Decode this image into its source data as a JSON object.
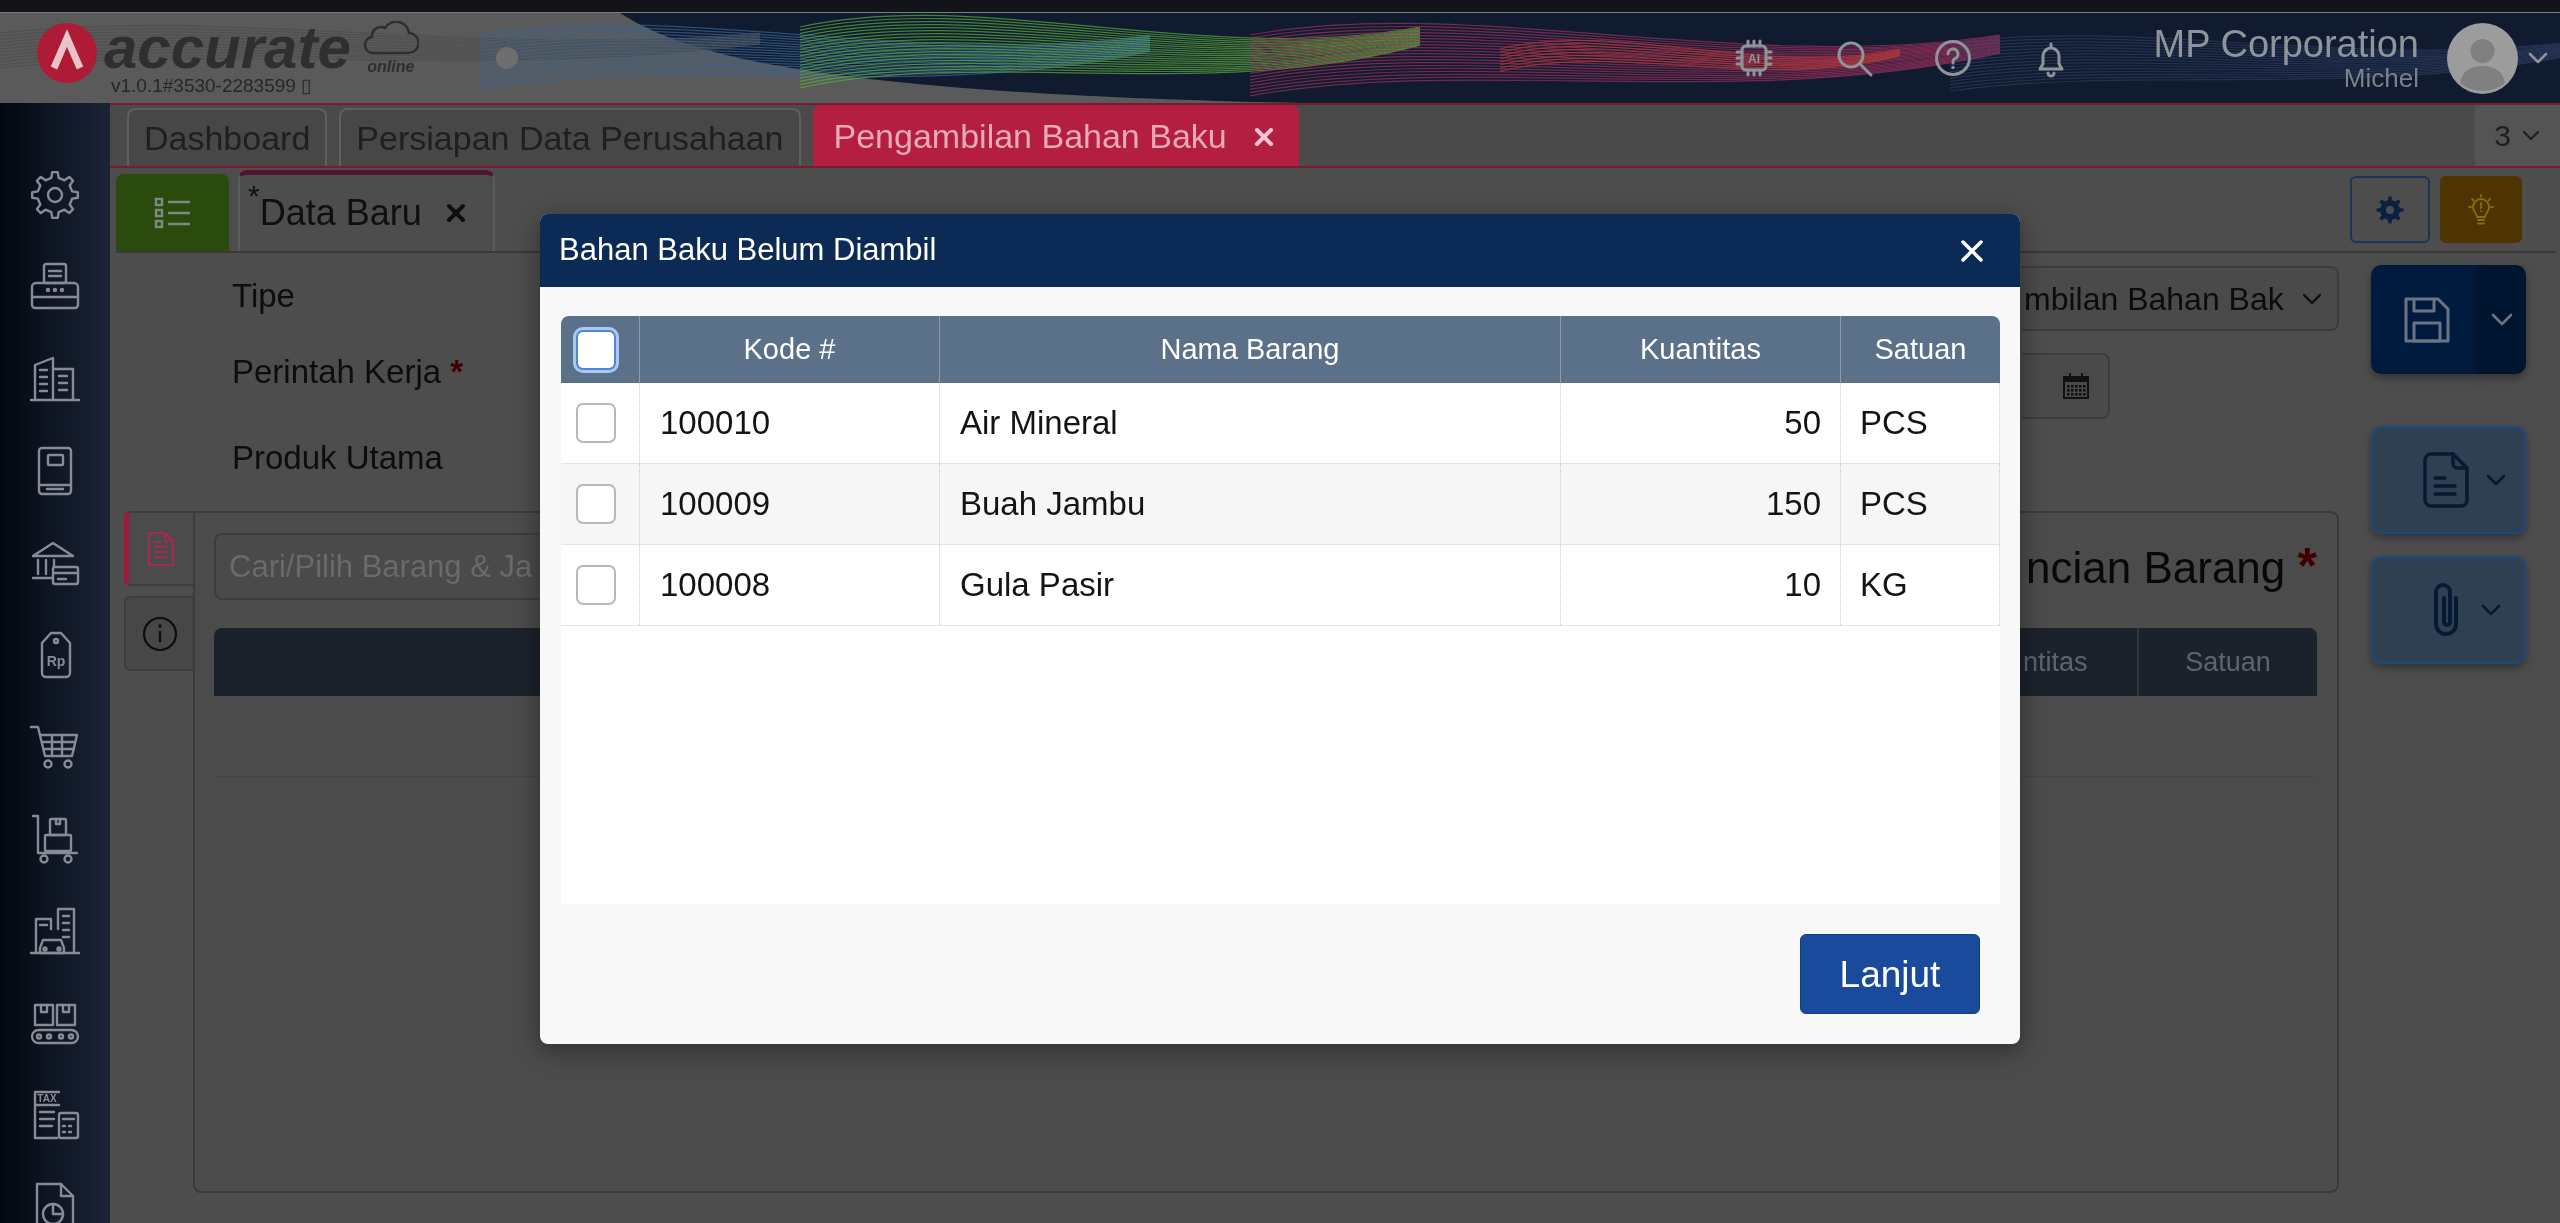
{
  "header": {
    "logo_text": "accurate",
    "logo_subtext": "online",
    "version": "v1.0.1#3530-2283599 ▯",
    "ai_label": "AI",
    "company": "MP Corporation",
    "user": "Michel"
  },
  "sidebar": {
    "items": [
      {
        "kind": "settings"
      },
      {
        "kind": "fax"
      },
      {
        "kind": "building"
      },
      {
        "kind": "book"
      },
      {
        "kind": "bank"
      },
      {
        "kind": "price_tag",
        "label": "Rp"
      },
      {
        "kind": "cart"
      },
      {
        "kind": "trolley"
      },
      {
        "kind": "city"
      },
      {
        "kind": "conveyor"
      },
      {
        "kind": "tax",
        "label": "TAX"
      },
      {
        "kind": "report"
      }
    ]
  },
  "tabs": [
    {
      "label": "Dashboard",
      "selected": false
    },
    {
      "label": "Persiapan Data Perusahaan",
      "selected": false
    },
    {
      "label": "Pengambilan Bahan Baku",
      "selected": true
    }
  ],
  "tab_counter": "3",
  "document_tabs": [
    {
      "label": "$^{*}$Data Baru",
      "selected": true
    }
  ],
  "form": {
    "fields": [
      {
        "label": "Tipe",
        "kind": "select",
        "value": "mbilan Bahan Bak"
      },
      {
        "label": "Perintah Kerja",
        "marker": "*",
        "kind": "date"
      },
      {
        "label": "Produk Utama"
      }
    ]
  },
  "detail_panel": {
    "side_tabs": [
      {
        "kind": "detail",
        "selected": true
      },
      {
        "kind": "info",
        "selected": false
      }
    ],
    "search": {
      "placeholder": "Cari/Pilih Barang & Ja"
    },
    "title": "ncian Barang",
    "title_marker": "*",
    "columns": [
      "ntitas",
      "Satuan"
    ]
  },
  "dialog": {
    "title": "Bahan Baku Belum Diambil",
    "select_all": {
      "checked": false,
      "focused": true
    },
    "columns": [
      "Kode #",
      "Nama Barang",
      "Kuantitas",
      "Satuan"
    ],
    "rows": [
      {
        "code": "100010",
        "name": "Air Mineral",
        "quantity": "50",
        "unit": "PCS",
        "checked": false
      },
      {
        "code": "100009",
        "name": "Buah Jambu",
        "quantity": "150",
        "unit": "PCS",
        "checked": false
      },
      {
        "code": "100008",
        "name": "Gula Pasir",
        "quantity": "10",
        "unit": "KG",
        "checked": false
      }
    ],
    "button": "Lanjut"
  }
}
